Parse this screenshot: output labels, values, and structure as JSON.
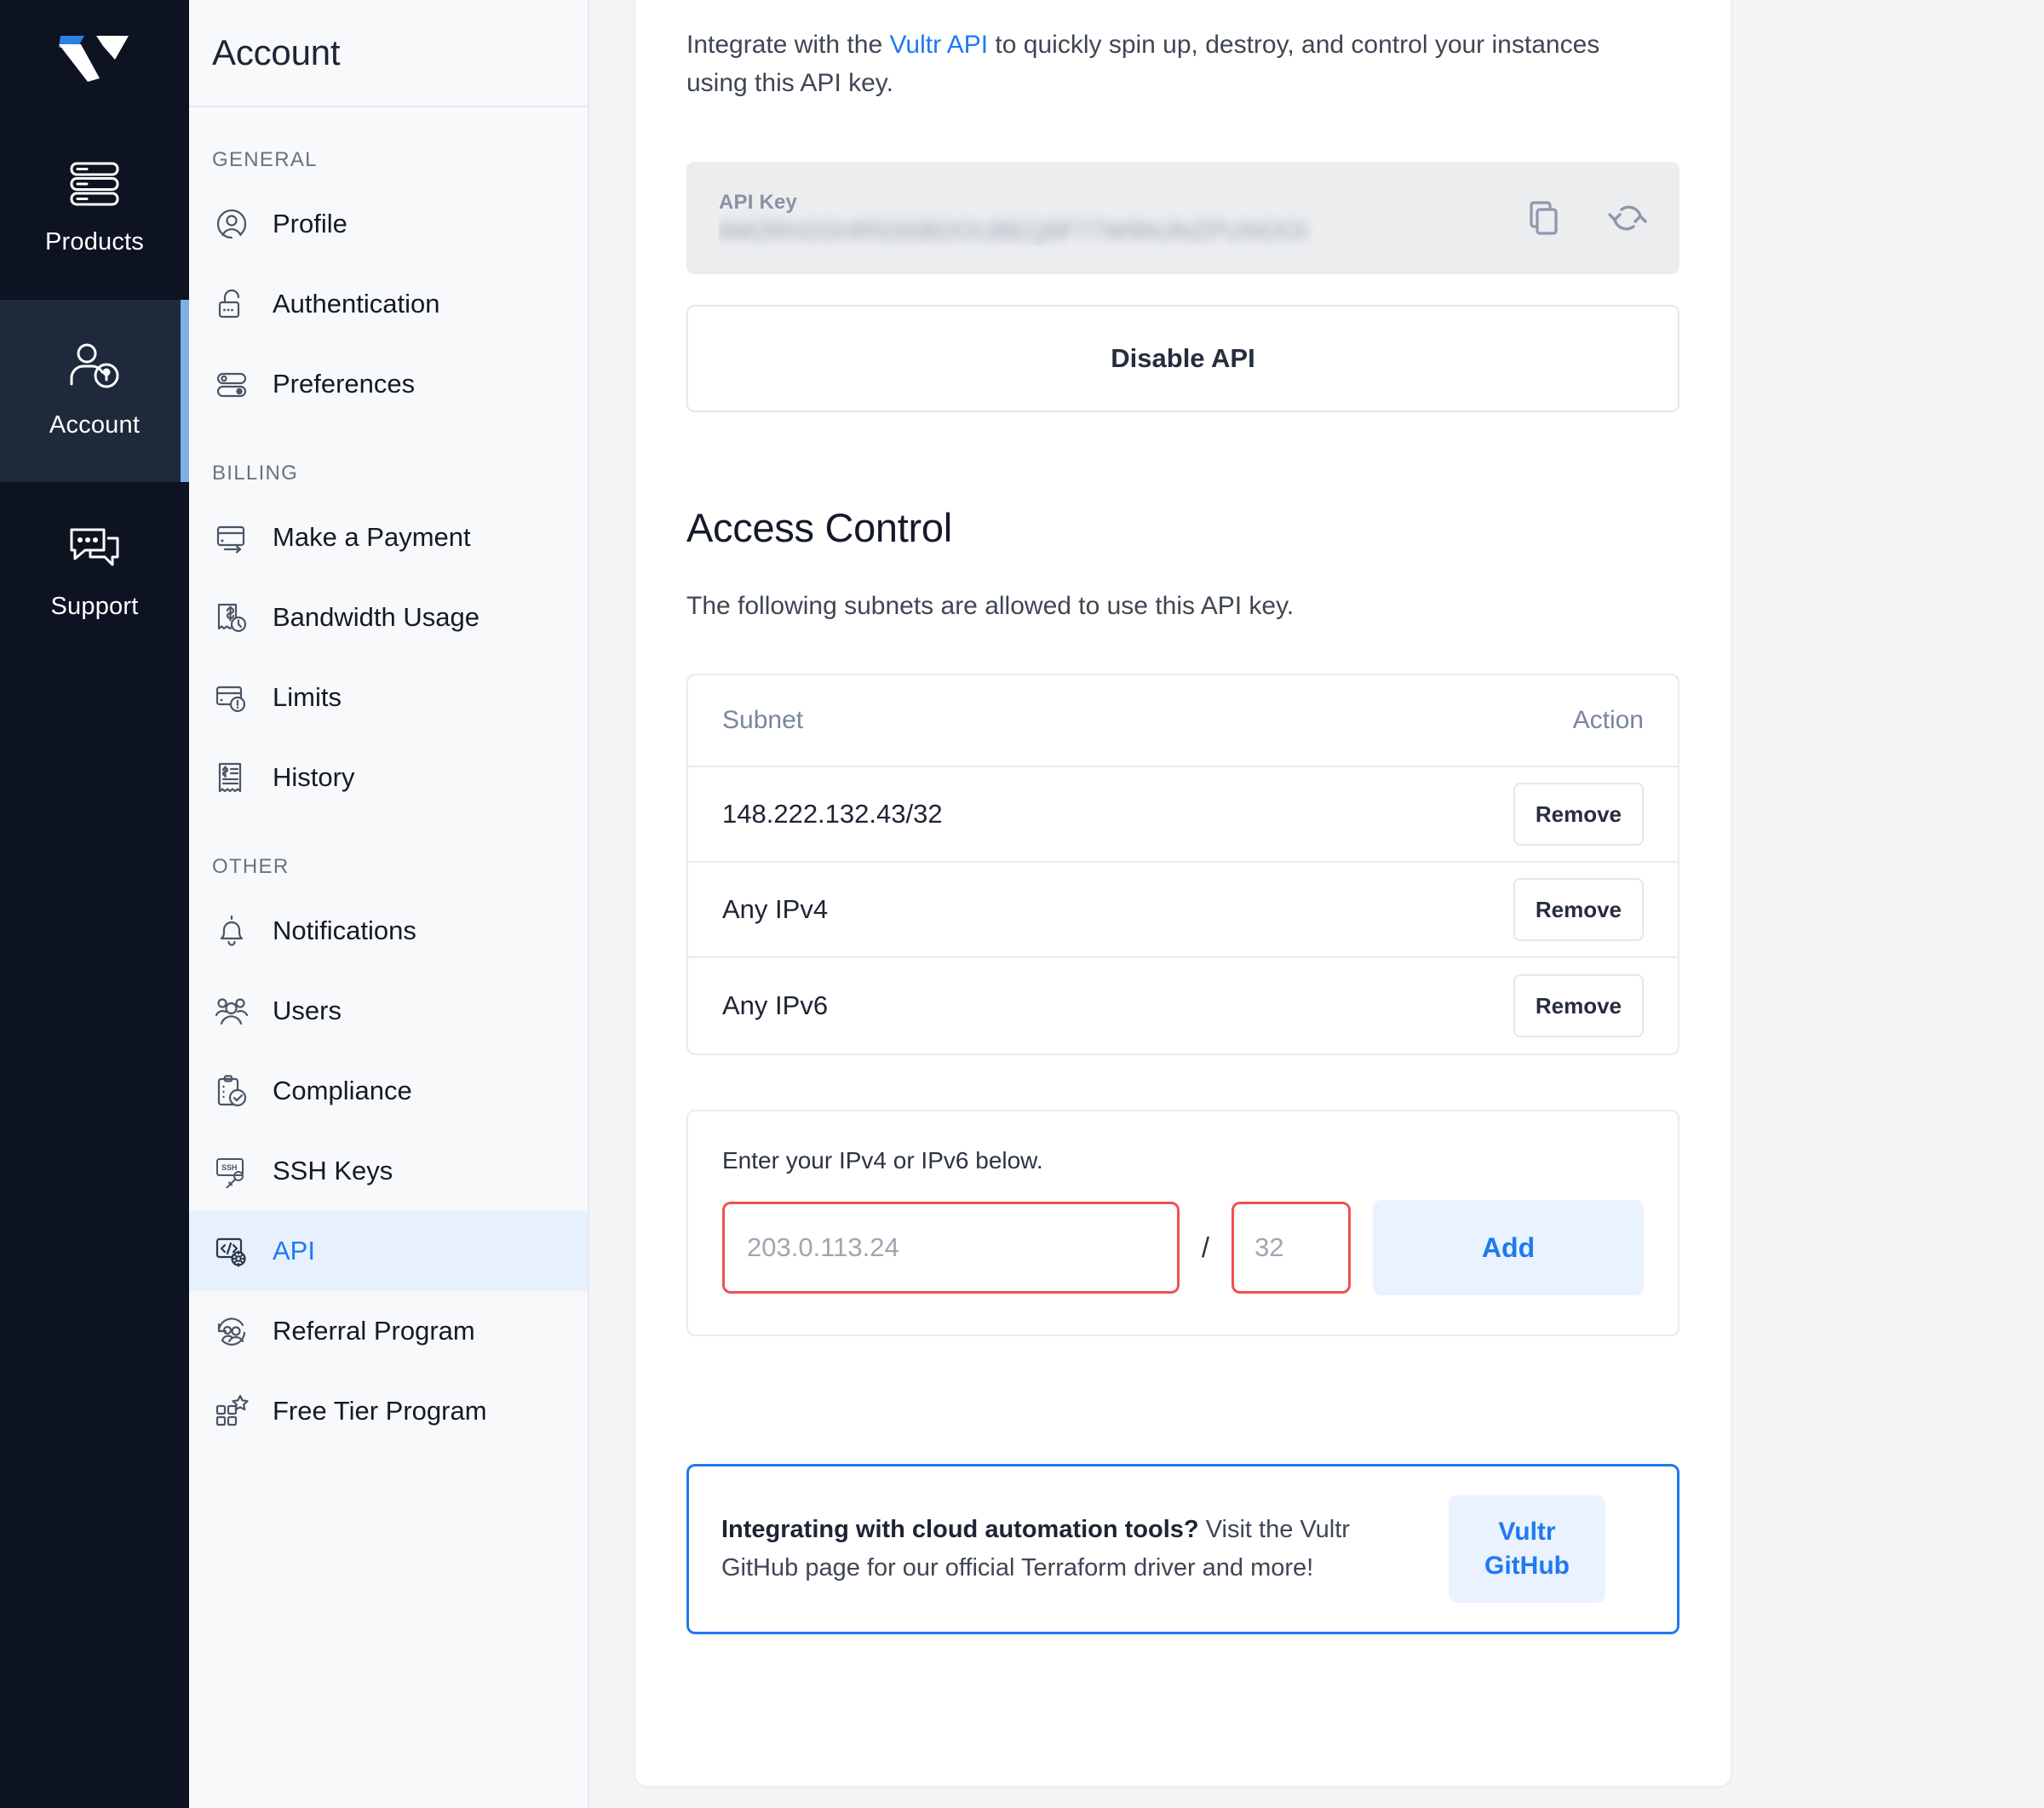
{
  "brand": {
    "logo_name": "vultr-logo",
    "accent_blue": "#1f7aef",
    "rail_bg": "#0d1321",
    "rail_active_bg": "#1e293b",
    "rail_active_indicator": "#7cb0e8",
    "error_red": "#f0514f"
  },
  "rail": {
    "items": [
      {
        "label": "Products",
        "icon": "server-stack-icon",
        "active": false
      },
      {
        "label": "Account",
        "icon": "user-account-icon",
        "active": true
      },
      {
        "label": "Support",
        "icon": "chat-bubbles-icon",
        "active": false
      }
    ]
  },
  "sidebar": {
    "title": "Account",
    "sections": [
      {
        "label": "GENERAL",
        "items": [
          {
            "label": "Profile",
            "icon": "profile-icon",
            "active": false
          },
          {
            "label": "Authentication",
            "icon": "unlock-padlock-icon",
            "active": false
          },
          {
            "label": "Preferences",
            "icon": "sliders-toggle-icon",
            "active": false
          }
        ]
      },
      {
        "label": "BILLING",
        "items": [
          {
            "label": "Make a Payment",
            "icon": "credit-card-arrow-icon",
            "active": false
          },
          {
            "label": "Bandwidth Usage",
            "icon": "receipt-clock-icon",
            "active": false
          },
          {
            "label": "Limits",
            "icon": "card-warning-icon",
            "active": false
          },
          {
            "label": "History",
            "icon": "invoice-icon",
            "active": false
          }
        ]
      },
      {
        "label": "OTHER",
        "items": [
          {
            "label": "Notifications",
            "icon": "bell-icon",
            "active": false
          },
          {
            "label": "Users",
            "icon": "users-group-icon",
            "active": false
          },
          {
            "label": "Compliance",
            "icon": "clipboard-check-icon",
            "active": false
          },
          {
            "label": "SSH Keys",
            "icon": "ssh-key-icon",
            "active": false
          },
          {
            "label": "API",
            "icon": "code-gear-icon",
            "active": true
          },
          {
            "label": "Referral Program",
            "icon": "referral-users-icon",
            "active": false
          },
          {
            "label": "Free Tier Program",
            "icon": "grid-star-icon",
            "active": false
          }
        ]
      }
    ]
  },
  "main": {
    "intro": {
      "before_link": "Integrate with the ",
      "link_text": "Vultr API",
      "after_link": " to quickly spin up, destroy, and control your instances using this API key."
    },
    "api_key": {
      "label": "API Key",
      "value": "6M2RH2GHR5S5BDOUBEQ8F77W9NJNZPUNOOI",
      "masked": true,
      "copy_icon": "copy-icon",
      "refresh_icon": "refresh-icon"
    },
    "disable_button": "Disable API",
    "access_control": {
      "title": "Access Control",
      "subtitle": "The following subnets are allowed to use this API key.",
      "table": {
        "columns": [
          "Subnet",
          "Action"
        ],
        "rows": [
          {
            "subnet": "148.222.132.43/32",
            "action": "Remove"
          },
          {
            "subnet": "Any IPv4",
            "action": "Remove"
          },
          {
            "subnet": "Any IPv6",
            "action": "Remove"
          }
        ]
      },
      "add_form": {
        "hint": "Enter your IPv4 or IPv6 below.",
        "ip_placeholder": "203.0.113.24",
        "ip_value": "",
        "separator": "/",
        "mask_placeholder": "32",
        "mask_value": "",
        "add_button": "Add",
        "ip_invalid": true,
        "mask_invalid": true
      }
    },
    "callout": {
      "bold_text": "Integrating with cloud automation tools?",
      "rest_text": " Visit the Vultr GitHub page for our official Terraform driver and more!",
      "button_line1": "Vultr",
      "button_line2": "GitHub"
    }
  }
}
